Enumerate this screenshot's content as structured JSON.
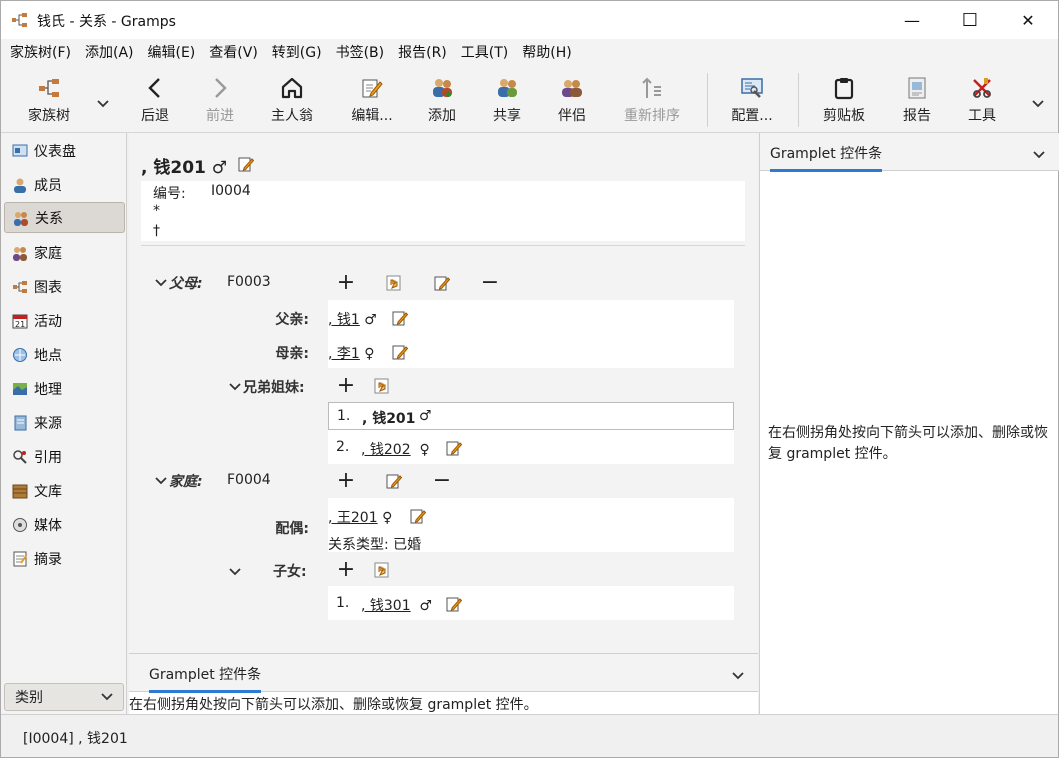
{
  "window": {
    "title": "钱氏 - 关系 - Gramps",
    "minimize": "—",
    "maximize": "☐",
    "close": "✕"
  },
  "menu": [
    "家族树(F)",
    "添加(A)",
    "编辑(E)",
    "查看(V)",
    "转到(G)",
    "书签(B)",
    "报告(R)",
    "工具(T)",
    "帮助(H)"
  ],
  "toolbar": {
    "family_tree": "家族树",
    "back": "后退",
    "forward": "前进",
    "home": "主人翁",
    "edit": "编辑...",
    "add": "添加",
    "share": "共享",
    "partner": "伴侣",
    "reorder": "重新排序",
    "config": "配置...",
    "clipboard": "剪贴板",
    "report": "报告",
    "tools": "工具"
  },
  "sidebar": {
    "items": [
      {
        "label": "仪表盘",
        "icon": "dashboard-icon"
      },
      {
        "label": "成员",
        "icon": "person-icon"
      },
      {
        "label": "关系",
        "icon": "relationship-icon"
      },
      {
        "label": "家庭",
        "icon": "family-icon"
      },
      {
        "label": "图表",
        "icon": "chart-icon"
      },
      {
        "label": "活动",
        "icon": "event-icon"
      },
      {
        "label": "地点",
        "icon": "place-icon"
      },
      {
        "label": "地理",
        "icon": "geography-icon"
      },
      {
        "label": "来源",
        "icon": "source-icon"
      },
      {
        "label": "引用",
        "icon": "citation-icon"
      },
      {
        "label": "文库",
        "icon": "repository-icon"
      },
      {
        "label": "媒体",
        "icon": "media-icon"
      },
      {
        "label": "摘录",
        "icon": "note-icon"
      }
    ],
    "category": "类别"
  },
  "person": {
    "name": ", 钱201",
    "gender": "♂",
    "id_label": "编号:",
    "id": "I0004",
    "birth": "*",
    "death": "†"
  },
  "parents": {
    "label": "父母:",
    "family_id": "F0003",
    "father_label": "父亲:",
    "father": ", 钱1",
    "father_gender": "♂",
    "mother_label": "母亲:",
    "mother": ", 李1",
    "mother_gender": "♀"
  },
  "siblings": {
    "label": "兄弟姐妹:",
    "items": [
      {
        "num": "1.",
        "name": ", 钱201",
        "gender": "♂"
      },
      {
        "num": "2.",
        "name": ", 钱202",
        "gender": "♀"
      }
    ]
  },
  "family": {
    "label": "家庭:",
    "family_id": "F0004",
    "spouse_label": "配偶:",
    "spouse": ", 王201",
    "spouse_gender": "♀",
    "relation_type": "关系类型: 已婚",
    "children_label": "子女:",
    "children": [
      {
        "num": "1.",
        "name": ", 钱301",
        "gender": "♂"
      }
    ]
  },
  "gramplet": {
    "tab": "Gramplet 控件条",
    "bottom_text": "在右侧拐角处按向下箭头可以添加、删除或恢复 gramplet 控件。",
    "right_text": "在右侧拐角处按向下箭头可以添加、删除或恢复 gramplet 控件。"
  },
  "status": "[I0004] , 钱201"
}
